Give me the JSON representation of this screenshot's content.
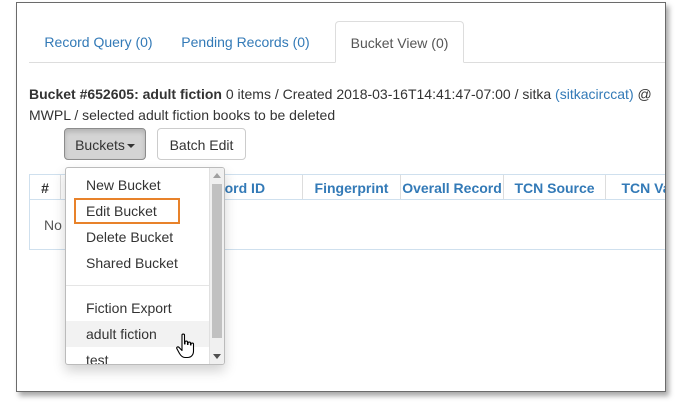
{
  "tabs": [
    {
      "label": "Record Query (0)"
    },
    {
      "label": "Pending Records (0)"
    },
    {
      "label": "Bucket View (0)"
    }
  ],
  "bucket_info": {
    "title": "Bucket #652605: adult fiction",
    "details_1": " 0 items / Created 2018-03-16T14:41:47-07:00 / sitka ",
    "owner_link": "(sitkacirccat)",
    "details_2": " @ MWPL / selected adult fiction books to be deleted"
  },
  "toolbar": {
    "buckets_label": "Buckets",
    "batch_edit_label": "Batch Edit"
  },
  "grid": {
    "columns": [
      "#",
      "",
      "Record ID",
      "Fingerprint",
      "Overall Record",
      "TCN Source",
      "TCN Va"
    ],
    "empty_text": "No"
  },
  "buckets_menu": {
    "items": [
      "New Bucket",
      "Edit Bucket",
      "Delete Bucket",
      "Shared Bucket"
    ],
    "bucket_list": [
      "Fiction Export",
      "adult fiction",
      "test"
    ]
  },
  "colors": {
    "link": "#337ab7",
    "highlight": "#e8822a"
  }
}
